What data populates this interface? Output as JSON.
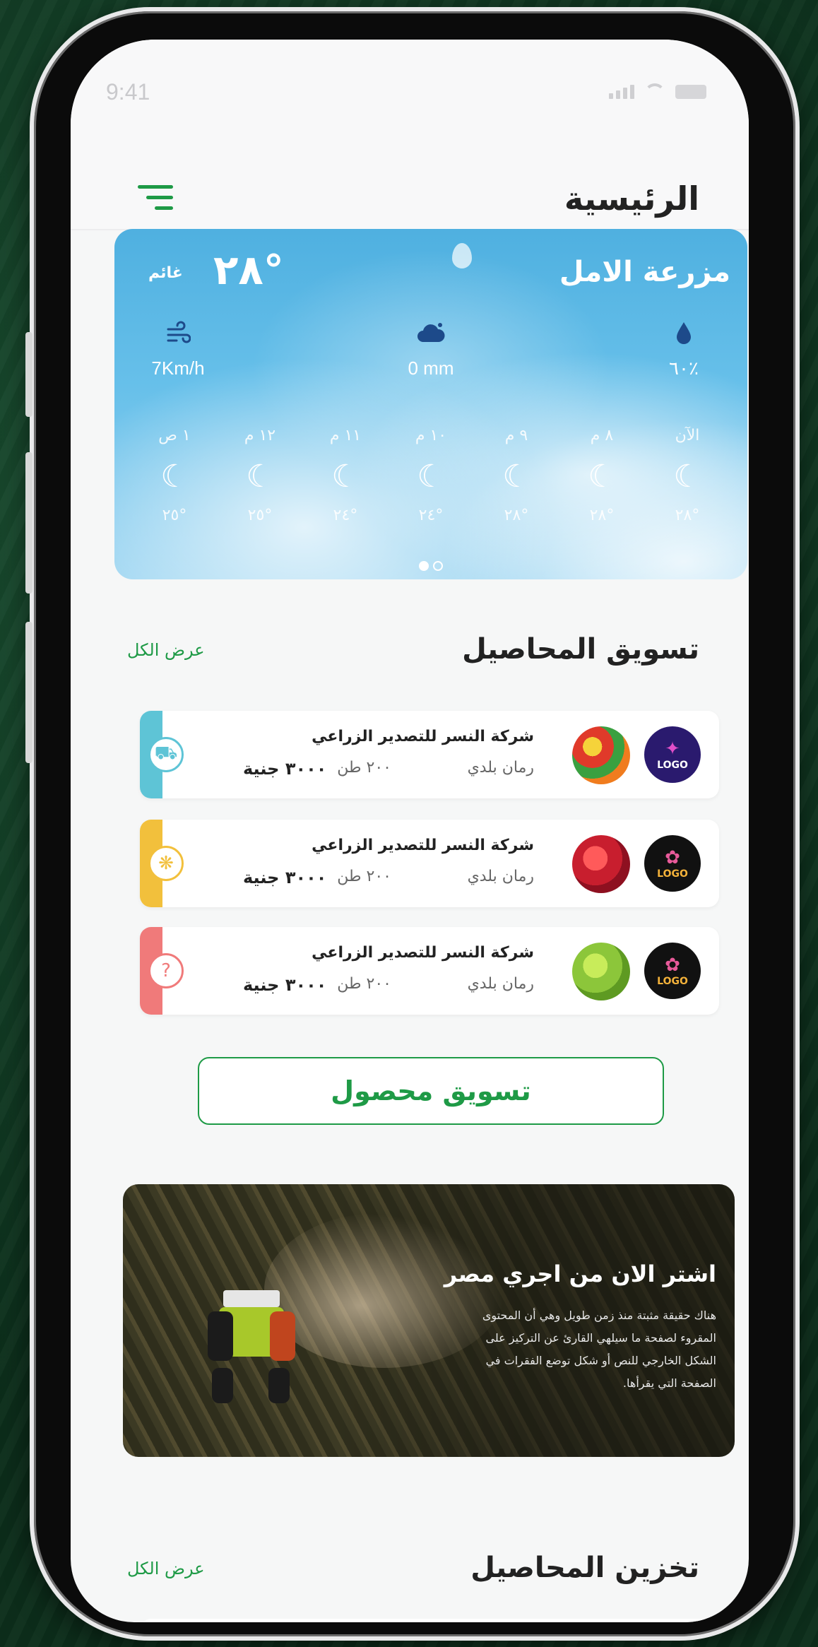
{
  "status_bar": {
    "time": "9:41"
  },
  "header": {
    "title": "الرئيسية",
    "menu_icon": "hamburger-menu-icon"
  },
  "weather": {
    "farm_name": "مزرعة الامل",
    "temperature": "٢٨°",
    "condition": "غائم",
    "stats": [
      {
        "icon": "wind-icon",
        "value": "7Km/h"
      },
      {
        "icon": "rain-cloud-icon",
        "value": "0 mm"
      },
      {
        "icon": "humidity-drop-icon",
        "value": "٦٠٪"
      }
    ],
    "hours": [
      {
        "label": "الآن",
        "temp": "٢٨°"
      },
      {
        "label": "٨ م",
        "temp": "٢٨°"
      },
      {
        "label": "٩ م",
        "temp": "٢٨°"
      },
      {
        "label": "١٠ م",
        "temp": "٢٤°"
      },
      {
        "label": "١١ م",
        "temp": "٢٤°"
      },
      {
        "label": "١٢ م",
        "temp": "٢٥°"
      },
      {
        "label": "١ ص",
        "temp": "٢٥°"
      }
    ],
    "page_count": 2,
    "active_page": 1
  },
  "marketing": {
    "title": "تسويق المحاصيل",
    "view_all": "عرض الكل",
    "items": [
      {
        "company": "شركة النسر للتصدير الزراعي",
        "crop": "رمان بلدي",
        "quantity": "٢٠٠ طن",
        "price": "٣٠٠٠ جنية",
        "accent": "#5ec4d6",
        "badge_icon": "truck-icon",
        "crop_image": "mixed-vegetables",
        "logo": "LOGO"
      },
      {
        "company": "شركة النسر للتصدير الزراعي",
        "crop": "رمان بلدي",
        "quantity": "٢٠٠ طن",
        "price": "٣٠٠٠ جنية",
        "accent": "#f2c03c",
        "badge_icon": "seeds-icon",
        "crop_image": "strawberries",
        "logo": "LOGO"
      },
      {
        "company": "شركة النسر للتصدير الزراعي",
        "crop": "رمان بلدي",
        "quantity": "٢٠٠ طن",
        "price": "٣٠٠٠ جنية",
        "accent": "#f07a7a",
        "badge_icon": "question-icon",
        "crop_image": "lettuce",
        "logo": "LOGO"
      }
    ],
    "cta": "تسويق محصول"
  },
  "banner": {
    "title": "اشتر الان من اجري مصر",
    "text": "هناك حقيقة مثبتة منذ زمن طويل وهي أن المحتوى المقروء لصفحة ما سيلهي القارئ عن التركيز على الشكل الخارجي للنص أو شكل توضع الفقرات في الصفحة التي يقرأها."
  },
  "storage": {
    "title": "تخزين المحاصيل",
    "view_all": "عرض الكل"
  },
  "colors": {
    "brand_green": "#1e9a46",
    "sky_blue": "#5ab5e4"
  }
}
